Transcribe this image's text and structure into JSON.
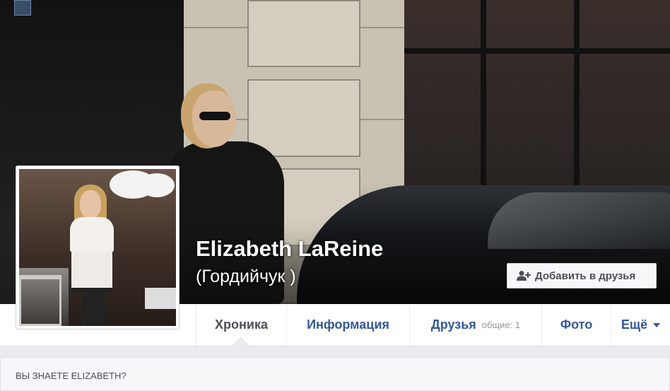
{
  "profile": {
    "name": "Elizabeth LaReine",
    "alternate_name": "(Гордийчук )"
  },
  "actions": {
    "add_friend_label": "Добавить в друзья"
  },
  "tabs": [
    {
      "label": "Хроника",
      "active": true
    },
    {
      "label": "Информация"
    },
    {
      "label": "Друзья",
      "count": "общие: 1"
    },
    {
      "label": "Фото"
    },
    {
      "label": "Ещё"
    }
  ],
  "sections": {
    "know_title": "ВЫ ЗНАЕТЕ ELIZABETH?"
  },
  "colors": {
    "link": "#365899",
    "text_dark": "#4b4f56",
    "background": "#e9ebee"
  },
  "icons": {
    "add_friend": "person-plus-icon",
    "more": "caret-down-icon"
  }
}
